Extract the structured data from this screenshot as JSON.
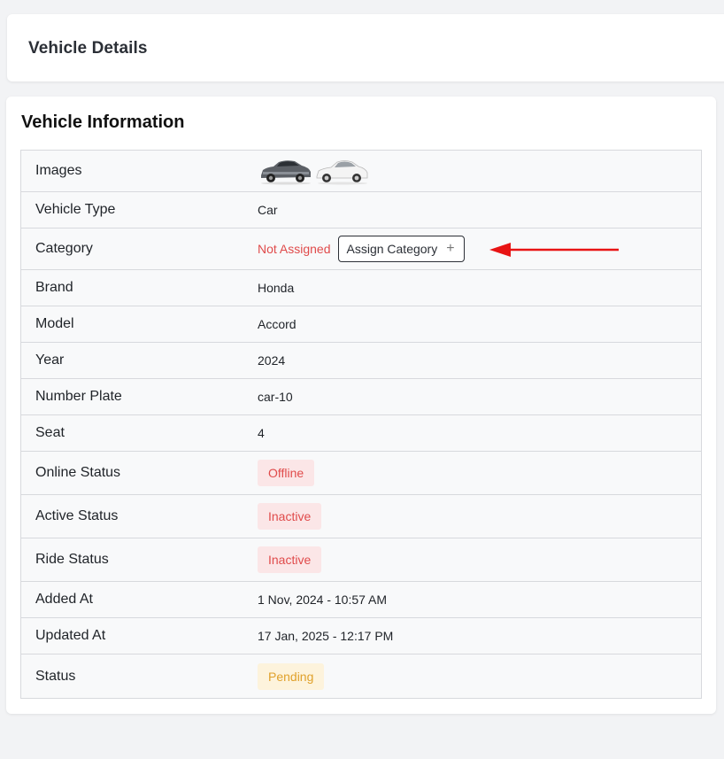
{
  "header": {
    "title": "Vehicle Details"
  },
  "card": {
    "title": "Vehicle Information"
  },
  "rows": {
    "images": {
      "label": "Images"
    },
    "vehicle_type": {
      "label": "Vehicle Type",
      "value": "Car"
    },
    "category": {
      "label": "Category",
      "value": "Not Assigned",
      "button_label": "Assign Category",
      "button_icon": "plus-icon"
    },
    "brand": {
      "label": "Brand",
      "value": "Honda"
    },
    "model": {
      "label": "Model",
      "value": "Accord"
    },
    "year": {
      "label": "Year",
      "value": "2024"
    },
    "number_plate": {
      "label": "Number Plate",
      "value": "car-10"
    },
    "seat": {
      "label": "Seat",
      "value": "4"
    },
    "online_status": {
      "label": "Online Status",
      "value": "Offline"
    },
    "active_status": {
      "label": "Active Status",
      "value": "Inactive"
    },
    "ride_status": {
      "label": "Ride Status",
      "value": "Inactive"
    },
    "added_at": {
      "label": "Added At",
      "value": "1 Nov, 2024 - 10:57 AM"
    },
    "updated_at": {
      "label": "Updated At",
      "value": "17 Jan, 2025 - 12:17 PM"
    },
    "status": {
      "label": "Status",
      "value": "Pending"
    }
  },
  "colors": {
    "danger": "#e04b4b",
    "danger_bg": "#fbe6e7",
    "warning": "#e0a12b",
    "warning_bg": "#fdf3dc",
    "annotation_arrow": "#e81414"
  }
}
